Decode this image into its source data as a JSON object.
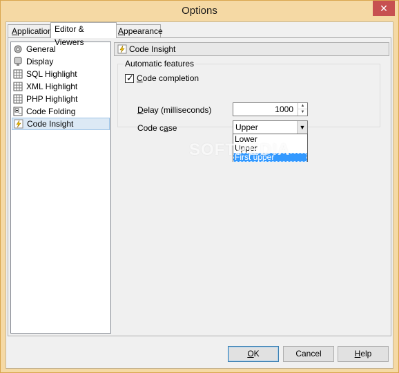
{
  "window": {
    "title": "Options",
    "close_glyph": "✕"
  },
  "tabs": [
    {
      "label": "Application",
      "underline": "A",
      "rest": "pplication",
      "active": false
    },
    {
      "label": "Editor & Viewers",
      "active": true
    },
    {
      "label": "Appearance",
      "underline": "A",
      "rest": "ppearance",
      "active": false
    }
  ],
  "sidebar": {
    "items": [
      {
        "label": "General",
        "icon": "general-icon"
      },
      {
        "label": "Display",
        "icon": "display-icon"
      },
      {
        "label": "SQL Highlight",
        "icon": "grid-icon"
      },
      {
        "label": "XML Highlight",
        "icon": "grid-icon"
      },
      {
        "label": "PHP Highlight",
        "icon": "grid-icon"
      },
      {
        "label": "Code Folding",
        "icon": "folding-icon"
      },
      {
        "label": "Code Insight",
        "icon": "lightning-icon",
        "selected": true
      }
    ]
  },
  "panel": {
    "header": "Code Insight",
    "group_label": "Automatic features",
    "code_completion": {
      "label": "Code completion",
      "underline": "C",
      "rest": "ode completion",
      "checked": true
    },
    "delay": {
      "label": "Delay (milliseconds)",
      "underline": "D",
      "rest": "elay (milliseconds)",
      "value": "1000"
    },
    "code_case": {
      "label": "Code case",
      "prefix": "Code c",
      "underline": "a",
      "rest": "se",
      "value": "Upper"
    },
    "dropdown_options": [
      "Lower",
      "Upper",
      "First upper"
    ],
    "highlighted_option": "First upper"
  },
  "watermark": "SOFTPEDIA",
  "footer": {
    "ok": {
      "label": "OK",
      "underline": "O",
      "rest": "K"
    },
    "cancel": {
      "label": "Cancel"
    },
    "help": {
      "label": "Help",
      "underline": "H",
      "rest": "elp"
    }
  },
  "colors": {
    "title_bar": "#f5d9a4",
    "close_button": "#c75050",
    "selection": "#3399ff"
  }
}
